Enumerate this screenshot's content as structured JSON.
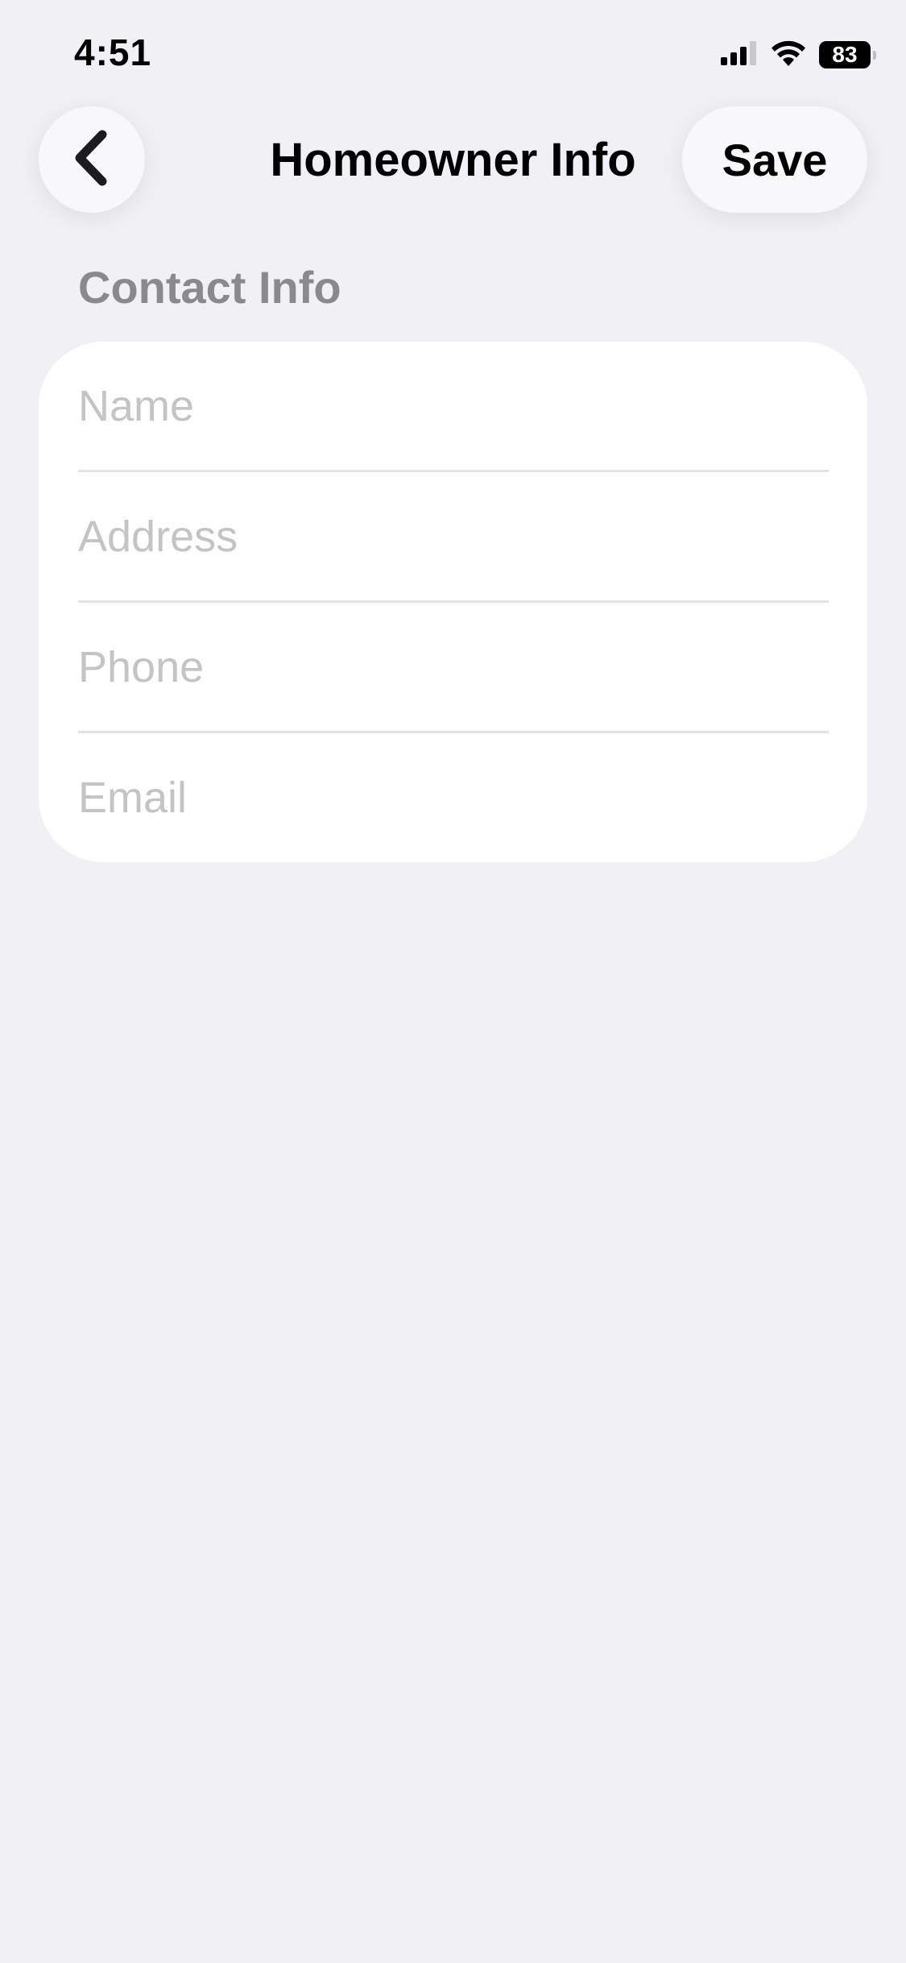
{
  "status_bar": {
    "time": "4:51",
    "battery_level": "83",
    "icons": [
      "cellular-signal-icon",
      "wifi-icon",
      "battery-icon"
    ]
  },
  "nav": {
    "back_icon": "chevron-left-icon",
    "title": "Homeowner Info",
    "save_label": "Save"
  },
  "contact_section": {
    "header": "Contact Info",
    "fields": [
      {
        "name": "name-field",
        "placeholder": "Name",
        "value": ""
      },
      {
        "name": "address-field",
        "placeholder": "Address",
        "value": ""
      },
      {
        "name": "phone-field",
        "placeholder": "Phone",
        "value": ""
      },
      {
        "name": "email-field",
        "placeholder": "Email",
        "value": ""
      }
    ]
  },
  "colors": {
    "background": "#f0f0f5",
    "card": "#ffffff",
    "section_header": "#8a8a8e",
    "placeholder": "#c4c4c7",
    "divider": "#e3e3e6"
  }
}
